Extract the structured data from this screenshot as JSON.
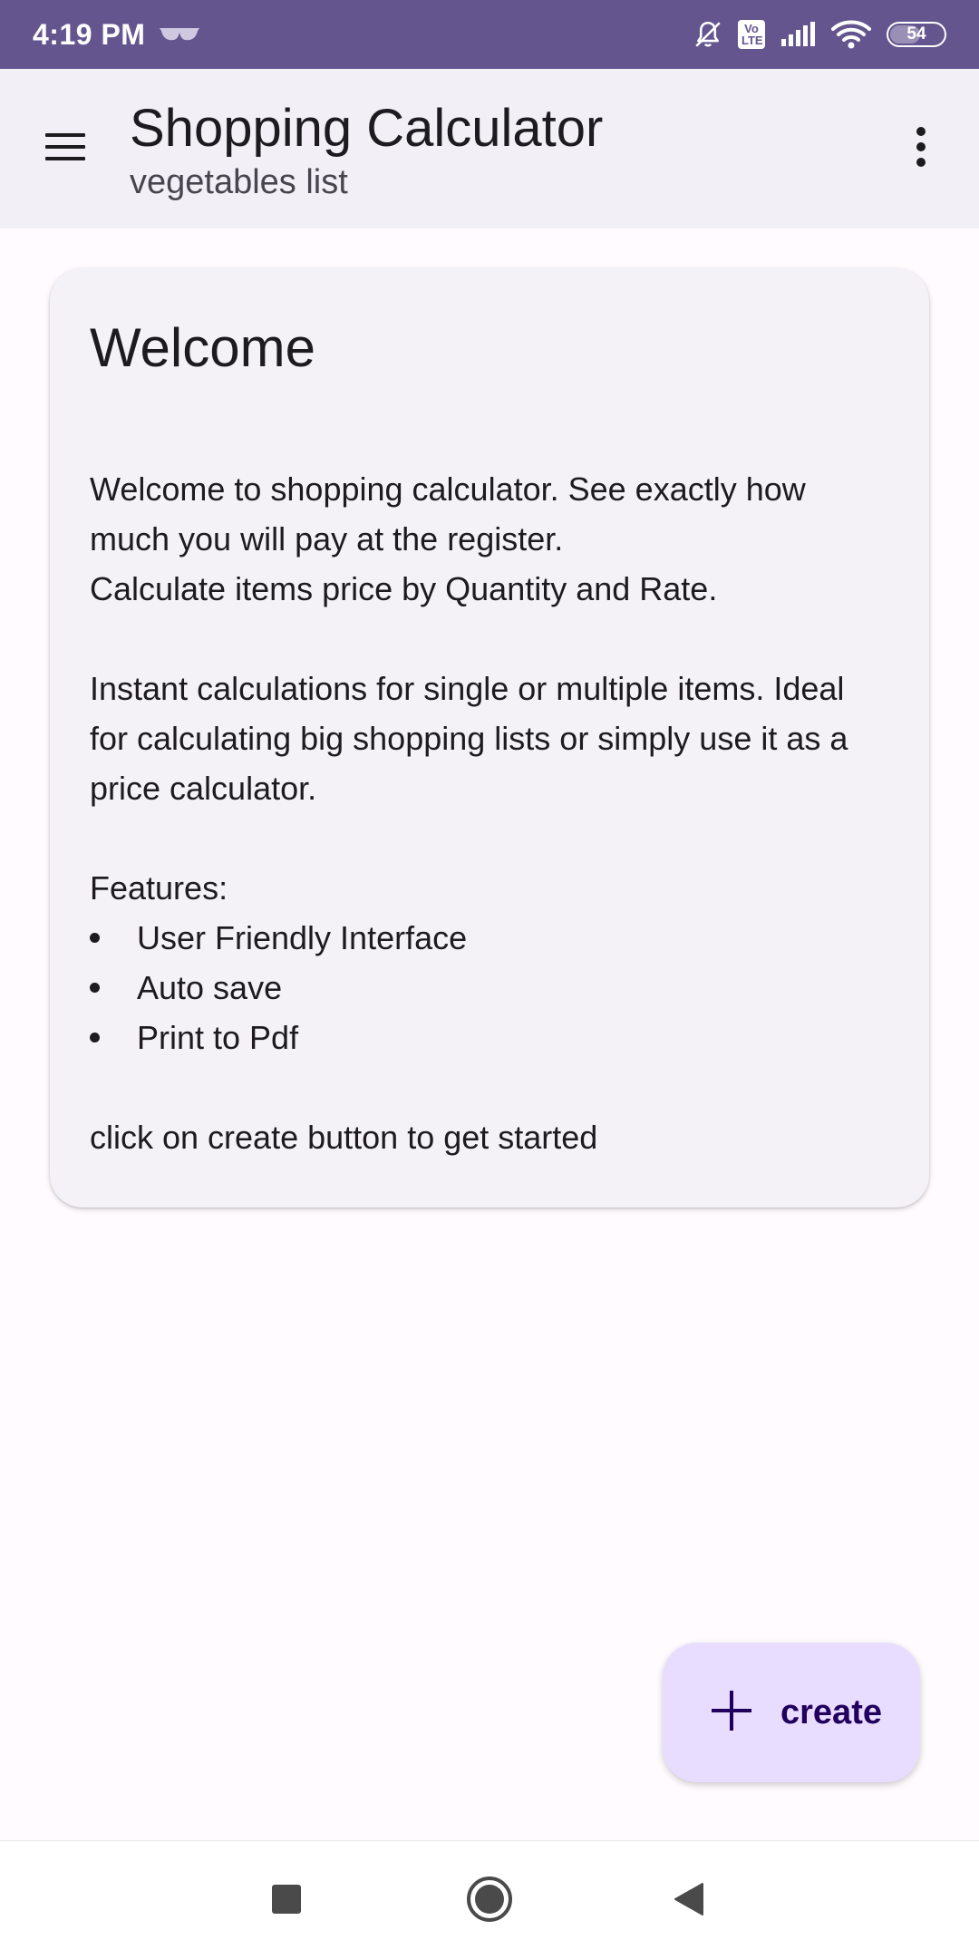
{
  "status_bar": {
    "time": "4:19 PM",
    "volte_text": "Vo\nLTE",
    "battery": "54",
    "icons": [
      "glasses-icon",
      "bell-off-icon",
      "volte-icon",
      "signal-icon",
      "wifi-icon",
      "battery-icon"
    ],
    "background_color": "#65558f"
  },
  "app_bar": {
    "title": "Shopping Calculator",
    "subtitle": "vegetables list",
    "menu_icon": "hamburger-menu-icon",
    "overflow_icon": "more-vert-icon",
    "background_color": "#f3eff6"
  },
  "welcome_card": {
    "title": "Welcome",
    "paragraph1_line1": "Welcome to shopping calculator. See exactly how much you will pay at the register.",
    "paragraph1_line2": "Calculate items price by Quantity and Rate.",
    "paragraph2": "Instant calculations for single or multiple items. Ideal for calculating big shopping lists or simply use it as a price calculator.",
    "features_heading": "Features:",
    "features": [
      "User Friendly Interface",
      "Auto save",
      "Print to Pdf"
    ],
    "footer": "click on create button to get started"
  },
  "fab": {
    "label": "create",
    "icon": "plus-icon",
    "background_color": "#e9ddff",
    "text_color": "#21005d"
  },
  "nav_bar": {
    "icons": [
      "recents-square-icon",
      "home-circle-icon",
      "back-triangle-icon"
    ]
  }
}
